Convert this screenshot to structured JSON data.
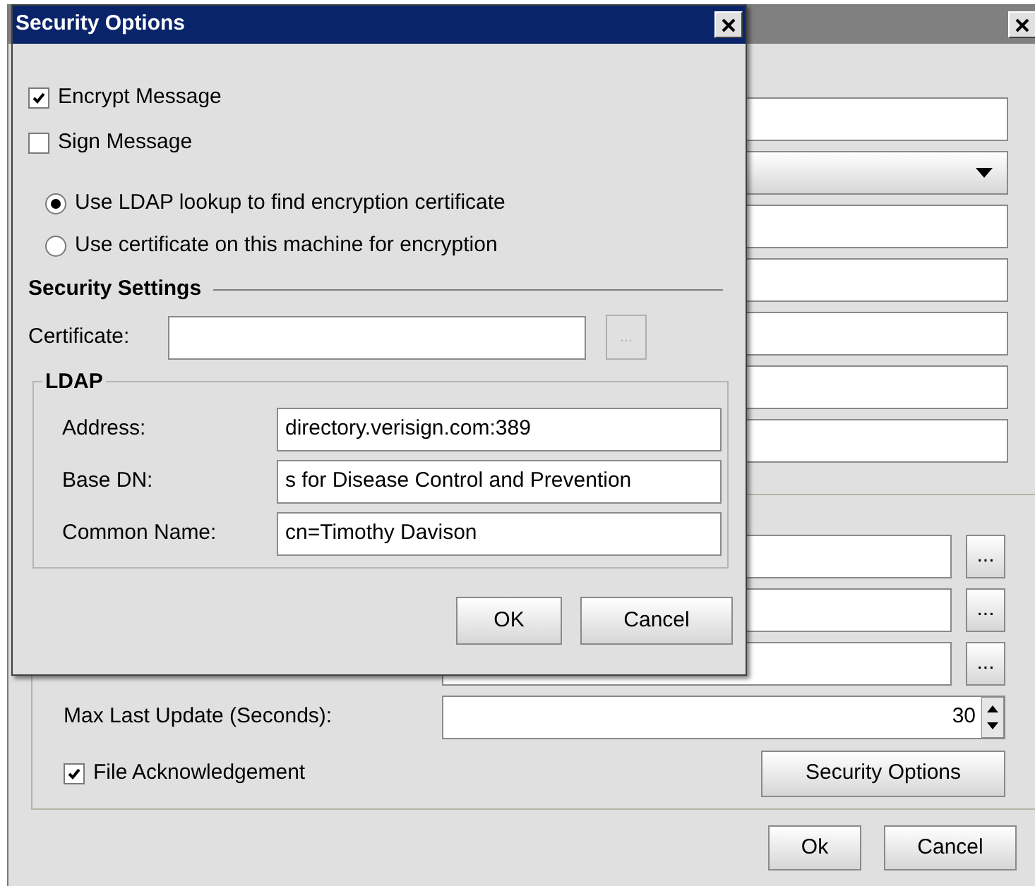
{
  "background_window": {
    "top_fields": [
      {
        "kind": "text"
      },
      {
        "kind": "dropdown"
      },
      {
        "kind": "text"
      },
      {
        "kind": "text"
      },
      {
        "kind": "text"
      },
      {
        "kind": "text"
      },
      {
        "kind": "text"
      }
    ],
    "group_rows": [
      {
        "kind": "browse",
        "button": "...",
        "disabled": false
      },
      {
        "kind": "browse",
        "button": "...",
        "disabled": false
      },
      {
        "kind": "browse",
        "button": "...",
        "disabled": false
      },
      {
        "kind": "spinner",
        "label": "Max Last Update (Seconds):",
        "value": "30"
      }
    ],
    "file_acknowledgement": {
      "label": "File Acknowledgement",
      "checked": true
    },
    "security_button": "Security Options",
    "buttons": [
      "Ok",
      "Cancel"
    ]
  },
  "dialog": {
    "title": "Security Options",
    "options": [
      {
        "label": "Encrypt Message",
        "checked": true
      },
      {
        "label": "Sign Message",
        "checked": false
      }
    ],
    "lookup": [
      {
        "label": "Use LDAP lookup to find encryption certificate",
        "selected": true
      },
      {
        "label": "Use certificate on this machine for encryption",
        "selected": false
      }
    ],
    "security_settings": {
      "title": "Security Settings",
      "certificate_label": "Certificate:",
      "browse": {
        "label": "...",
        "disabled": true
      }
    },
    "ldap": {
      "title": "LDAP",
      "fields": [
        {
          "label": "Address:",
          "value": "directory.verisign.com:389"
        },
        {
          "label": "Base DN:",
          "value": "s for Disease Control and Prevention"
        },
        {
          "label": "Common Name:",
          "value": "cn=Timothy Davison"
        }
      ]
    },
    "buttons": [
      "OK",
      "Cancel"
    ]
  }
}
